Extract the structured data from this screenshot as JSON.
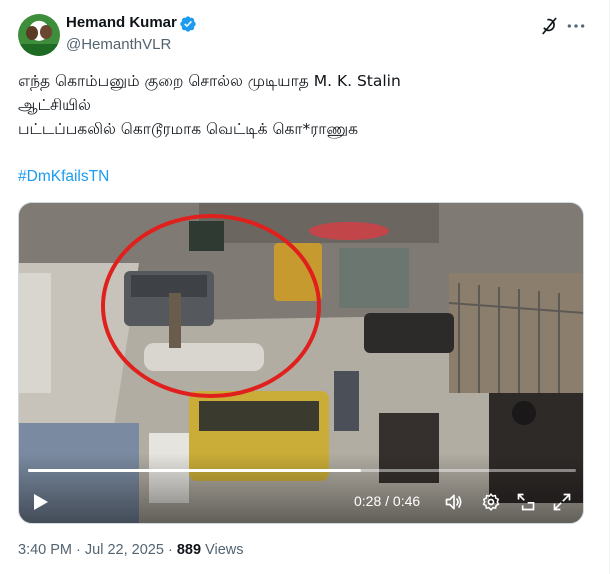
{
  "author": {
    "name": "Hemand Kumar",
    "handle": "@HemanthVLR"
  },
  "tweet": {
    "lines": [
      "எந்த கொம்பனும் குறை சொல்ல முடியாத M. K. Stalin",
      "ஆட்சியில்",
      "பட்டப்பகலில் கொடூரமாக வெட்டிக் கொ*ராணுக"
    ],
    "hashtag": "#DmKfailsTN"
  },
  "video": {
    "current_time": "0:28",
    "separator": "/",
    "duration": "0:46",
    "progress_fraction": 0.608
  },
  "meta": {
    "time": "3:40 PM",
    "dot": "·",
    "date": "Jul 22, 2025",
    "views_count": "889",
    "views_label": "Views"
  },
  "colors": {
    "accent": "#1d9bf0",
    "secondary_text": "#536471",
    "primary_text": "#0f1419",
    "highlight_circle": "#e0201c"
  },
  "icons": {
    "verified": "verified-badge-icon",
    "grok": "grok-icon",
    "more": "more-dots-icon",
    "play": "play-icon",
    "volume": "volume-icon",
    "settings": "gear-icon",
    "pip": "picture-in-picture-icon",
    "fullscreen": "fullscreen-icon"
  }
}
